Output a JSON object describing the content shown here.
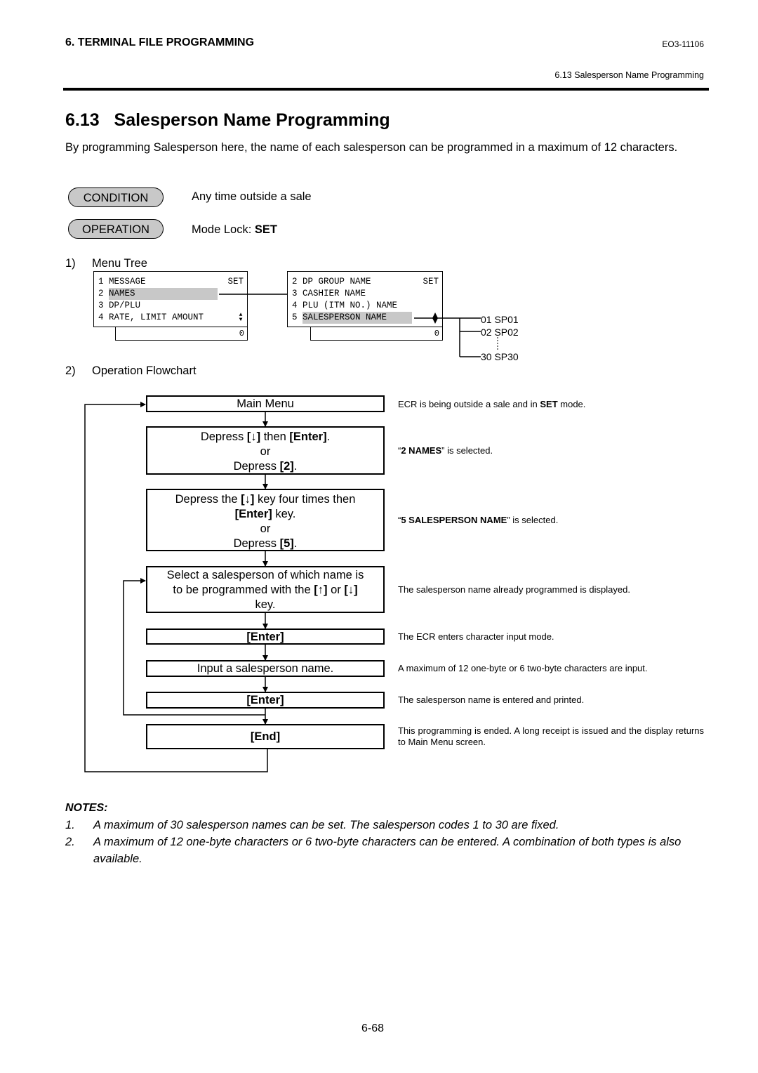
{
  "header": {
    "chapter": "6. TERMINAL FILE PROGRAMMING",
    "doc_code": "EO3-11106",
    "section_ref": "6.13 Salesperson Name Programming"
  },
  "section": {
    "number": "6.13",
    "title": "Salesperson Name Programming",
    "intro": "By programming Salesperson here, the name of each salesperson can be programmed in a maximum of 12 characters."
  },
  "condition": {
    "label": "CONDITION",
    "value": "Any time outside a sale"
  },
  "operation": {
    "label": "OPERATION",
    "value_prefix": "Mode Lock: ",
    "value_bold": "SET"
  },
  "menu_tree": {
    "step": "1)",
    "label": "Menu Tree",
    "screen1": {
      "rows": [
        "1 MESSAGE",
        "2 ",
        "3 DP/PLU",
        "4 RATE, LIMIT AMOUNT"
      ],
      "highlight": "NAMES",
      "set": "SET",
      "scroll_icon": "▲▼",
      "counter": "0"
    },
    "screen2": {
      "rows": [
        "2 DP GROUP NAME",
        "3 CASHIER NAME",
        "4 PLU (ITM NO.) NAME",
        "5 "
      ],
      "highlight": "SALESPERSON NAME",
      "set": "SET",
      "counter": "0"
    },
    "branches": [
      "01 SP01",
      "02 SP02",
      "30 SP30"
    ]
  },
  "flowchart": {
    "step": "2)",
    "label": "Operation Flowchart",
    "boxes": {
      "main_menu": "Main Menu",
      "b2_l1_a": "Depress ",
      "b2_l1_b": "[↓]",
      "b2_l1_c": " then ",
      "b2_l1_d": "[Enter]",
      "b2_l1_e": ".",
      "or": "or",
      "b2_l3_a": "Depress ",
      "b2_l3_b": "[2]",
      "b2_l3_c": ".",
      "b3_l1_a": "Depress the ",
      "b3_l1_b": "[↓]",
      "b3_l1_c": " key four times then",
      "b3_l2_a": "[Enter]",
      "b3_l2_b": " key.",
      "b3_l4_a": "Depress ",
      "b3_l4_b": "[5]",
      "b3_l4_c": ".",
      "b4_l1": "Select a salesperson of which name is",
      "b4_l2_a": "to be programmed with the ",
      "b4_l2_b": "[↑]",
      "b4_l2_c": " or ",
      "b4_l2_d": "[↓]",
      "b4_l3": "key.",
      "enter1": "[Enter]",
      "input": "Input a salesperson name.",
      "enter2": "[Enter]",
      "end": "[End]"
    },
    "notes": {
      "n1_a": "ECR is being outside a sale and in ",
      "n1_b": "SET",
      "n1_c": " mode.",
      "n2_a": "“",
      "n2_b": "2 NAMES",
      "n2_c": "” is selected.",
      "n3_a": "“",
      "n3_b": "5 SALESPERSON NAME",
      "n3_c": "” is selected.",
      "n4": "The salesperson name already programmed is displayed.",
      "n5": "The ECR enters character input mode.",
      "n6": "A maximum of 12 one-byte or 6 two-byte characters are input.",
      "n7": "The salesperson name is entered and printed.",
      "n8": "This programming is ended.  A long receipt is issued and the display returns to Main Menu screen."
    }
  },
  "notes": {
    "title": "NOTES:",
    "items": [
      {
        "num": "1.",
        "text": "A maximum of 30 salesperson names can be set.  The salesperson codes 1 to 30 are fixed."
      },
      {
        "num": "2.",
        "text": "A maximum of 12 one-byte characters or 6 two-byte characters can be entered.  A combination of both types is also available."
      }
    ]
  },
  "page_number": "6-68"
}
